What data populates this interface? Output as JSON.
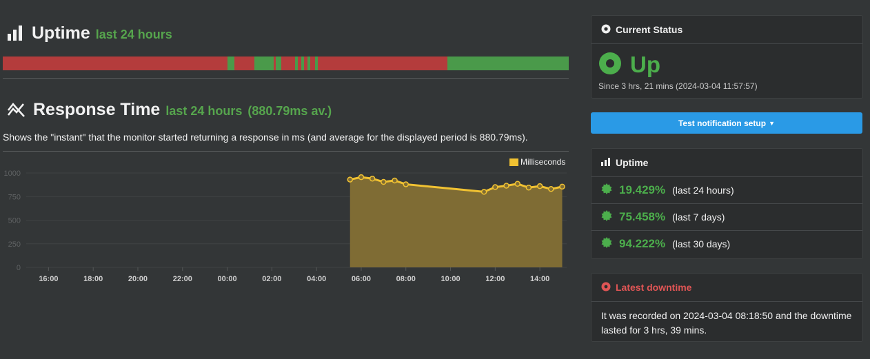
{
  "uptime_section": {
    "title": "Uptime",
    "period": "last 24 hours",
    "bar": [
      {
        "status": "down",
        "pct": 39.7
      },
      {
        "status": "up",
        "pct": 1.2
      },
      {
        "status": "down",
        "pct": 3.5
      },
      {
        "status": "up",
        "pct": 3.5
      },
      {
        "status": "down",
        "pct": 0.3
      },
      {
        "status": "up",
        "pct": 1.0
      },
      {
        "status": "down",
        "pct": 2.4
      },
      {
        "status": "up",
        "pct": 0.5
      },
      {
        "status": "down",
        "pct": 0.6
      },
      {
        "status": "up",
        "pct": 0.5
      },
      {
        "status": "down",
        "pct": 0.6
      },
      {
        "status": "up",
        "pct": 0.5
      },
      {
        "status": "down",
        "pct": 0.9
      },
      {
        "status": "up",
        "pct": 0.5
      },
      {
        "status": "down",
        "pct": 22.9
      },
      {
        "status": "up",
        "pct": 21.4
      }
    ]
  },
  "response_section": {
    "title": "Response Time",
    "period": "last 24 hours",
    "average": "(880.79ms av.)",
    "description": "Shows the \"instant\" that the monitor started returning a response in ms (and average for the displayed period is 880.79ms)."
  },
  "chart_data": {
    "type": "area",
    "legend": "Milliseconds",
    "legend_position": "top-right",
    "ylim": [
      0,
      1000
    ],
    "yticks": [
      "0",
      "250",
      "500",
      "750",
      "1000"
    ],
    "xticks": [
      "16:00",
      "18:00",
      "20:00",
      "22:00",
      "00:00",
      "02:00",
      "04:00",
      "06:00",
      "08:00",
      "10:00",
      "12:00",
      "14:00"
    ],
    "x_range_hours": [
      15.0,
      39.2
    ],
    "x_tick_hours": [
      16,
      18,
      20,
      22,
      24,
      26,
      28,
      30,
      32,
      34,
      36,
      38
    ],
    "points": [
      {
        "t": "05:30",
        "h": 29.5,
        "v": 930
      },
      {
        "t": "06:00",
        "h": 30.0,
        "v": 955
      },
      {
        "t": "06:30",
        "h": 30.5,
        "v": 940
      },
      {
        "t": "07:00",
        "h": 31.0,
        "v": 905
      },
      {
        "t": "07:30",
        "h": 31.5,
        "v": 920
      },
      {
        "t": "08:00",
        "h": 32.0,
        "v": 880
      },
      {
        "t": "11:30",
        "h": 35.5,
        "v": 800
      },
      {
        "t": "12:00",
        "h": 36.0,
        "v": 850
      },
      {
        "t": "12:30",
        "h": 36.5,
        "v": 865
      },
      {
        "t": "13:00",
        "h": 37.0,
        "v": 885
      },
      {
        "t": "13:30",
        "h": 37.5,
        "v": 845
      },
      {
        "t": "14:00",
        "h": 38.0,
        "v": 860
      },
      {
        "t": "14:30",
        "h": 38.5,
        "v": 830
      },
      {
        "t": "15:00",
        "h": 39.0,
        "v": 855
      }
    ],
    "colors": {
      "line": "#f1c232",
      "fill": "#7f6c34",
      "point": "#7f6c34",
      "grid": "#3f4243",
      "tick": "#555858",
      "label": "#d0d0d0"
    }
  },
  "current_status": {
    "heading": "Current Status",
    "state": "Up",
    "since": "Since 3 hrs, 21 mins (2024-03-04 11:57:57)"
  },
  "notify_button": {
    "label": "Test notification setup"
  },
  "uptime_card": {
    "heading": "Uptime",
    "rows": [
      {
        "pct": "19.429%",
        "period": "(last 24 hours)"
      },
      {
        "pct": "75.458%",
        "period": "(last 7 days)"
      },
      {
        "pct": "94.222%",
        "period": "(last 30 days)"
      }
    ]
  },
  "latest_downtime": {
    "heading": "Latest downtime",
    "text": "It was recorded on 2024-03-04 08:18:50 and the downtime lasted for 3 hrs, 39 mins."
  },
  "colors": {
    "up": "#4cae4c",
    "down": "#c0392b",
    "accent": "#2a9ae6",
    "bar_up": "#4a9a4a",
    "bar_down": "#b43c3c"
  },
  "icons": [
    "bar-chart-icon",
    "line-chart-icon",
    "dot-circle-icon",
    "caret-down-icon",
    "badge-check-icon",
    "alert-circle-icon"
  ]
}
